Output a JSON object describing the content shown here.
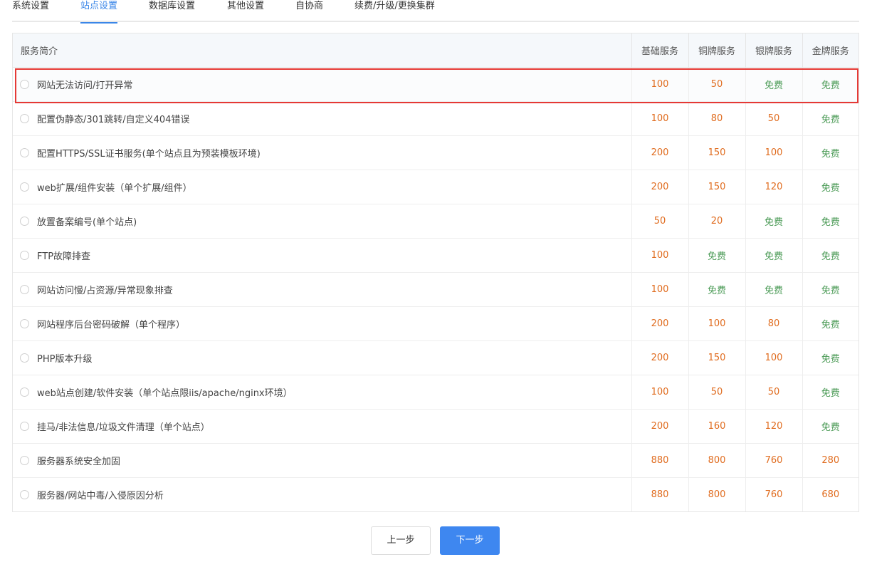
{
  "tabs": [
    "系统设置",
    "站点设置",
    "数据库设置",
    "其他设置",
    "自协商",
    "续费/升级/更换集群"
  ],
  "active_tab_index": 1,
  "table": {
    "headers": [
      "服务简介",
      "基础服务",
      "铜牌服务",
      "银牌服务",
      "金牌服务"
    ],
    "rows": [
      {
        "label": "网站无法访问/打开异常",
        "values": [
          "100",
          "50",
          "免费",
          "免费"
        ]
      },
      {
        "label": "配置伪静态/301跳转/自定义404错误",
        "values": [
          "100",
          "80",
          "50",
          "免费"
        ]
      },
      {
        "label": "配置HTTPS/SSL证书服务(单个站点且为预装模板环境)",
        "values": [
          "200",
          "150",
          "100",
          "免费"
        ]
      },
      {
        "label": "web扩展/组件安装（单个扩展/组件）",
        "values": [
          "200",
          "150",
          "120",
          "免费"
        ]
      },
      {
        "label": "放置备案编号(单个站点)",
        "values": [
          "50",
          "20",
          "免费",
          "免费"
        ]
      },
      {
        "label": "FTP故障排查",
        "values": [
          "100",
          "免费",
          "免费",
          "免费"
        ]
      },
      {
        "label": "网站访问慢/占资源/异常现象排查",
        "values": [
          "100",
          "免费",
          "免费",
          "免费"
        ]
      },
      {
        "label": "网站程序后台密码破解（单个程序）",
        "values": [
          "200",
          "100",
          "80",
          "免费"
        ]
      },
      {
        "label": "PHP版本升级",
        "values": [
          "200",
          "150",
          "100",
          "免费"
        ]
      },
      {
        "label": "web站点创建/软件安装（单个站点限iis/apache/nginx环境）",
        "values": [
          "100",
          "50",
          "50",
          "免费"
        ]
      },
      {
        "label": "挂马/非法信息/垃圾文件清理（单个站点）",
        "values": [
          "200",
          "160",
          "120",
          "免费"
        ]
      },
      {
        "label": "服务器系统安全加固",
        "values": [
          "880",
          "800",
          "760",
          "280"
        ]
      },
      {
        "label": "服务器/网站中毒/入侵原因分析",
        "values": [
          "880",
          "800",
          "760",
          "680"
        ]
      }
    ],
    "highlighted_row_index": 0
  },
  "buttons": {
    "prev": "上一步",
    "next": "下一步"
  },
  "colors": {
    "accent": "#3a86e8",
    "price": "#e06c1f",
    "free": "#4a9a55",
    "highlight": "#e53935"
  }
}
